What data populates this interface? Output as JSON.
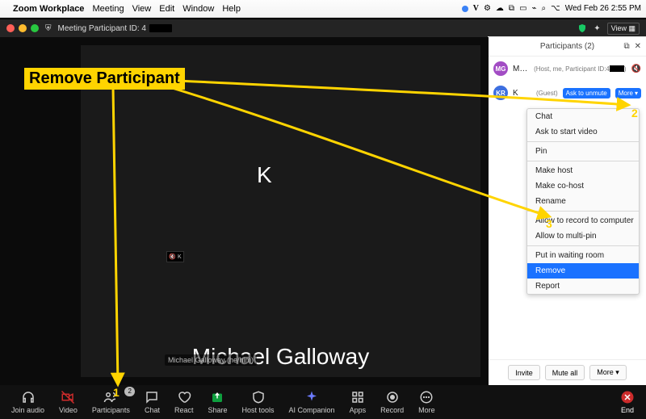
{
  "mac_menu": {
    "app_name": "Zoom Workplace",
    "items": [
      "Meeting",
      "View",
      "Edit",
      "Window",
      "Help"
    ],
    "clock": "Wed Feb 26  2:55 PM"
  },
  "titlebar": {
    "id_label": "Meeting Participant ID: 4",
    "view_label": "View"
  },
  "video": {
    "top_initial": "K",
    "main_name": "Michael Galloway",
    "name_tag": "Michael Galloway (he/him)",
    "mini_label": "K"
  },
  "toolbar": {
    "join_audio": "Join audio",
    "video": "Video",
    "participants": "Participants",
    "participants_badge": "2",
    "chat": "Chat",
    "react": "React",
    "share": "Share",
    "host_tools": "Host tools",
    "ai": "AI Companion",
    "apps": "Apps",
    "record": "Record",
    "more": "More",
    "end": "End"
  },
  "participants": {
    "title": "Participants (2)",
    "rows": [
      {
        "initials": "MG",
        "name": "Michael…",
        "meta": "(Host, me, Participant ID:4",
        "mask": true,
        "mic_off": true
      },
      {
        "initials": "KR",
        "name": "K",
        "meta": "(Guest)",
        "ask_unmute": "Ask to unmute",
        "more": "More"
      }
    ],
    "footer": {
      "invite": "Invite",
      "mute_all": "Mute all",
      "more": "More"
    }
  },
  "context_menu": [
    "Chat",
    "Ask to start video",
    "—",
    "Pin",
    "—",
    "Make host",
    "Make co-host",
    "Rename",
    "—",
    "Allow to record to computer",
    "Allow to multi-pin",
    "—",
    "Put in waiting room",
    "Remove",
    "Report"
  ],
  "context_menu_highlight": "Remove",
  "annotation": {
    "title": "Remove Participant",
    "n1": "1",
    "n2": "2",
    "n3": "3"
  }
}
